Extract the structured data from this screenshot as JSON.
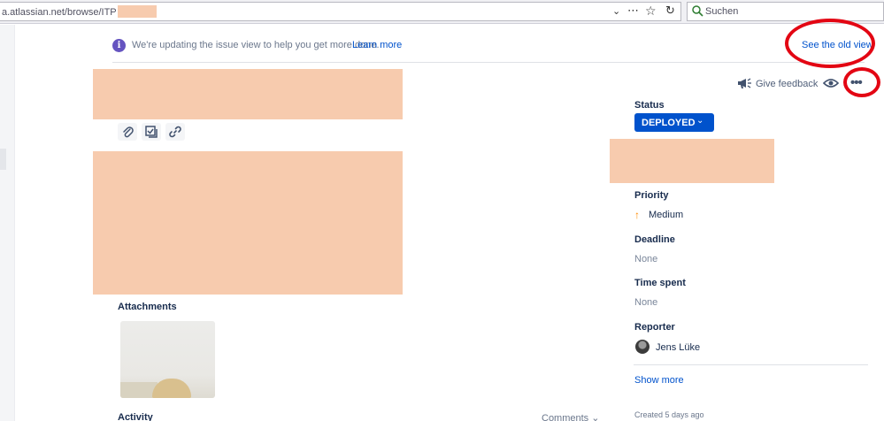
{
  "browser": {
    "url": "a.atlassian.net/browse/ITP",
    "search_placeholder": "Suchen",
    "icons": {
      "dropdown": "chevron-down-icon",
      "more": "ellipsis-icon",
      "bookmark": "star-icon",
      "reload": "reload-icon",
      "search": "search-icon"
    }
  },
  "banner": {
    "icon": "info-icon",
    "text": "We're updating the issue view to help you get more done.",
    "learn_more": "Learn more",
    "old_view": "See the old view"
  },
  "toolbar": {
    "icons": [
      "paperclip-icon",
      "checklist-icon",
      "link-icon"
    ]
  },
  "attachments": {
    "label": "Attachments"
  },
  "activity": {
    "label": "Activity",
    "filter": "Comments"
  },
  "header_actions": {
    "feedback": "Give feedback",
    "icons": [
      "megaphone-icon",
      "eye-icon",
      "more-icon"
    ],
    "more": "•••"
  },
  "fields": {
    "status": {
      "label": "Status",
      "value": "DEPLOYED"
    },
    "priority": {
      "label": "Priority",
      "value": "Medium"
    },
    "deadline": {
      "label": "Deadline",
      "value": "None"
    },
    "time_spent": {
      "label": "Time spent",
      "value": "None"
    },
    "reporter": {
      "label": "Reporter",
      "value": "Jens Lüke"
    }
  },
  "show_more": "Show more",
  "created": "Created 5 days ago",
  "colors": {
    "accent": "#0052cc",
    "redaction": "#f7cbae",
    "annotation": "#e30613",
    "priority": "#ff8b00"
  }
}
